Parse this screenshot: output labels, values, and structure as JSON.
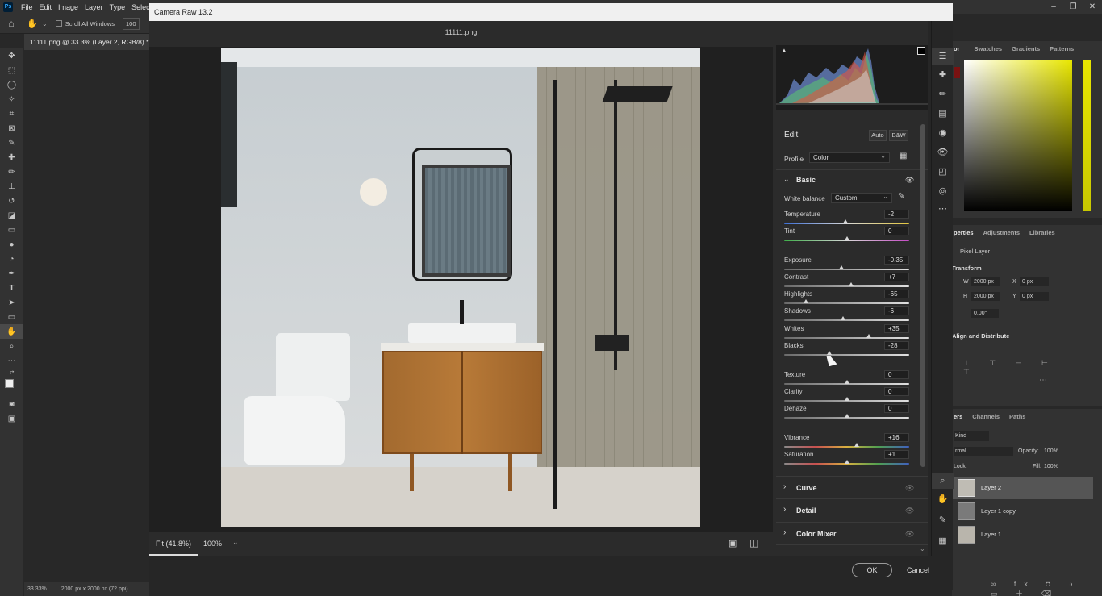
{
  "ps": {
    "logo": "Ps",
    "menu": [
      "File",
      "Edit",
      "Image",
      "Layer",
      "Type",
      "Select"
    ],
    "options": {
      "scroll_all": "Scroll All Windows",
      "zoom_partial": "100"
    },
    "doc_tab": "11111.png @ 33.3% (Layer 2, RGB/8) *",
    "status": {
      "zoom": "33.33%",
      "info": "2000 px x 2000 px (72 ppi)"
    },
    "panel_tabs_top": [
      "or",
      "Swatches",
      "Gradients",
      "Patterns"
    ],
    "panel_tabs_mid": [
      "perties",
      "Adjustments",
      "Libraries"
    ],
    "properties": {
      "pixel_layer": "Pixel Layer",
      "transform": "Transform",
      "w_label": "W",
      "w": "2000 px",
      "x_label": "X",
      "x": "0 px",
      "h_label": "H",
      "h": "2000 px",
      "y_label": "Y",
      "y": "0 px",
      "angle": "0.00°",
      "align": "Align and Distribute"
    },
    "panel_tabs_layers": [
      "ers",
      "Channels",
      "Paths"
    ],
    "layers_controls": {
      "kind": "Kind",
      "blend": "rmal",
      "opacity_label": "Opacity:",
      "opacity": "100%",
      "lock_label": "Lock:",
      "fill_label": "Fill:",
      "fill": "100%"
    },
    "layers": [
      "Layer 2",
      "Layer 1 copy",
      "Layer 1"
    ]
  },
  "cr": {
    "title": "Camera Raw 13.2",
    "filename": "11111.png",
    "zoom_fit": "Fit (41.8%)",
    "zoom_pct": "100%",
    "ok": "OK",
    "cancel": "Cancel",
    "edit_label": "Edit",
    "auto": "Auto",
    "bw": "B&W",
    "profile_label": "Profile",
    "profile_value": "Color",
    "basic": "Basic",
    "wb_label": "White balance",
    "wb_value": "Custom",
    "sliders": [
      {
        "label": "Temperature",
        "value": "-2",
        "pos": 0.49,
        "track": "temp"
      },
      {
        "label": "Tint",
        "value": "0",
        "pos": 0.5,
        "track": "tint"
      },
      {
        "label": "Exposure",
        "value": "-0.35",
        "pos": 0.46,
        "track": "gray"
      },
      {
        "label": "Contrast",
        "value": "+7",
        "pos": 0.535,
        "track": "gray"
      },
      {
        "label": "Highlights",
        "value": "-65",
        "pos": 0.175,
        "track": "gray"
      },
      {
        "label": "Shadows",
        "value": "-6",
        "pos": 0.47,
        "track": "gray"
      },
      {
        "label": "Whites",
        "value": "+35",
        "pos": 0.675,
        "track": "gray"
      },
      {
        "label": "Blacks",
        "value": "-28",
        "pos": 0.36,
        "track": "gray"
      },
      {
        "label": "Texture",
        "value": "0",
        "pos": 0.5,
        "track": "gray"
      },
      {
        "label": "Clarity",
        "value": "0",
        "pos": 0.5,
        "track": "gray"
      },
      {
        "label": "Dehaze",
        "value": "0",
        "pos": 0.5,
        "track": "gray"
      },
      {
        "label": "Vibrance",
        "value": "+16",
        "pos": 0.58,
        "track": "vib"
      },
      {
        "label": "Saturation",
        "value": "+1",
        "pos": 0.505,
        "track": "sat"
      }
    ],
    "sections": [
      "Curve",
      "Detail",
      "Color Mixer"
    ],
    "colors": {
      "accent": "#31a8ff",
      "panel": "#2b2b2b",
      "ok_border": "#9a9a9a"
    }
  }
}
